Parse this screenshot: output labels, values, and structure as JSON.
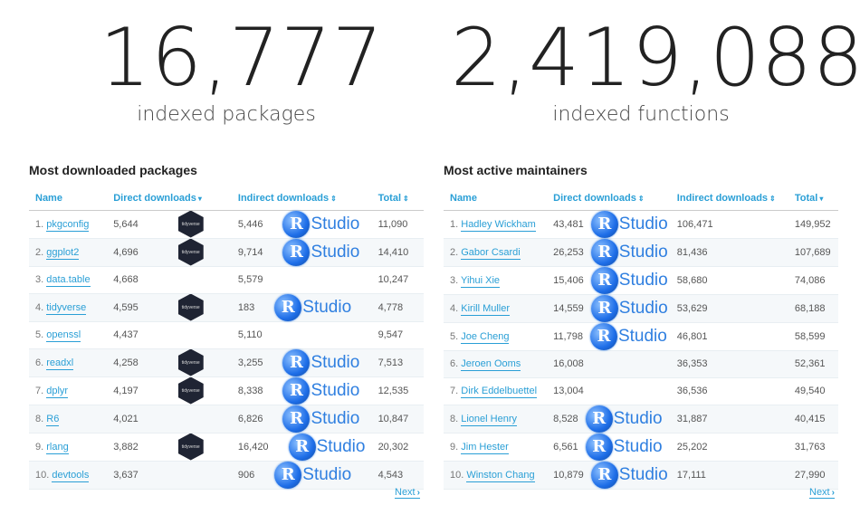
{
  "stats": {
    "packages": {
      "number": "16,777",
      "label": "indexed packages"
    },
    "functions": {
      "number": "2,419,088",
      "label": "indexed functions"
    }
  },
  "left_panel": {
    "title": "Most downloaded packages",
    "headers": {
      "name": "Name",
      "direct": "Direct downloads",
      "indirect": "Indirect downloads",
      "total": "Total"
    },
    "sort_icons": {
      "direct": "▾",
      "indirect": "⇕",
      "total": "⇕"
    },
    "rows": [
      {
        "rank": "1.",
        "name": "pkgconfig",
        "direct": "5,644",
        "indirect": "5,446",
        "total": "11,090",
        "tidyverse": true,
        "rstudio": true
      },
      {
        "rank": "2.",
        "name": "ggplot2",
        "direct": "4,696",
        "indirect": "9,714",
        "total": "14,410",
        "tidyverse": true,
        "rstudio": true
      },
      {
        "rank": "3.",
        "name": "data.table",
        "direct": "4,668",
        "indirect": "5,579",
        "total": "10,247",
        "tidyverse": false,
        "rstudio": false
      },
      {
        "rank": "4.",
        "name": "tidyverse",
        "direct": "4,595",
        "indirect": "183",
        "total": "4,778",
        "tidyverse": true,
        "rstudio": true
      },
      {
        "rank": "5.",
        "name": "openssl",
        "direct": "4,437",
        "indirect": "5,110",
        "total": "9,547",
        "tidyverse": false,
        "rstudio": false
      },
      {
        "rank": "6.",
        "name": "readxl",
        "direct": "4,258",
        "indirect": "3,255",
        "total": "7,513",
        "tidyverse": true,
        "rstudio": true
      },
      {
        "rank": "7.",
        "name": "dplyr",
        "direct": "4,197",
        "indirect": "8,338",
        "total": "12,535",
        "tidyverse": true,
        "rstudio": true
      },
      {
        "rank": "8.",
        "name": "R6",
        "direct": "4,021",
        "indirect": "6,826",
        "total": "10,847",
        "tidyverse": false,
        "rstudio": true
      },
      {
        "rank": "9.",
        "name": "rlang",
        "direct": "3,882",
        "indirect": "16,420",
        "total": "20,302",
        "tidyverse": true,
        "rstudio": true
      },
      {
        "rank": "10.",
        "name": "devtools",
        "direct": "3,637",
        "indirect": "906",
        "total": "4,543",
        "tidyverse": false,
        "rstudio": true
      }
    ],
    "next_label": "Next"
  },
  "right_panel": {
    "title": "Most active maintainers",
    "headers": {
      "name": "Name",
      "direct": "Direct downloads",
      "indirect": "Indirect downloads",
      "total": "Total"
    },
    "sort_icons": {
      "direct": "⇕",
      "indirect": "⇕",
      "total": "▾"
    },
    "rows": [
      {
        "rank": "1.",
        "name": "Hadley Wickham",
        "direct": "43,481",
        "indirect": "106,471",
        "total": "149,952",
        "rstudio": true
      },
      {
        "rank": "2.",
        "name": "Gabor Csardi",
        "direct": "26,253",
        "indirect": "81,436",
        "total": "107,689",
        "rstudio": true
      },
      {
        "rank": "3.",
        "name": "Yihui Xie",
        "direct": "15,406",
        "indirect": "58,680",
        "total": "74,086",
        "rstudio": true
      },
      {
        "rank": "4.",
        "name": "Kirill Muller",
        "direct": "14,559",
        "indirect": "53,629",
        "total": "68,188",
        "rstudio": true
      },
      {
        "rank": "5.",
        "name": "Joe Cheng",
        "direct": "11,798",
        "indirect": "46,801",
        "total": "58,599",
        "rstudio": true
      },
      {
        "rank": "6.",
        "name": "Jeroen Ooms",
        "direct": "16,008",
        "indirect": "36,353",
        "total": "52,361",
        "rstudio": false
      },
      {
        "rank": "7.",
        "name": "Dirk Eddelbuettel",
        "direct": "13,004",
        "indirect": "36,536",
        "total": "49,540",
        "rstudio": false
      },
      {
        "rank": "8.",
        "name": "Lionel Henry",
        "direct": "8,528",
        "indirect": "31,887",
        "total": "40,415",
        "rstudio": true
      },
      {
        "rank": "9.",
        "name": "Jim Hester",
        "direct": "6,561",
        "indirect": "25,202",
        "total": "31,763",
        "rstudio": true
      },
      {
        "rank": "10.",
        "name": "Winston Chang",
        "direct": "10,879",
        "indirect": "17,111",
        "total": "27,990",
        "rstudio": true
      }
    ],
    "next_label": "Next"
  },
  "badges": {
    "tidyverse_text": "tidyverse",
    "rstudio_r": "R",
    "rstudio_text": "Studio"
  },
  "colors": {
    "accent": "#2a9fd6",
    "rstudio_blue": "#2f7fe0",
    "tidyverse_hex": "#1f2433"
  },
  "icons": {
    "next": "chevron-right-icon",
    "sort_desc": "caret-down-icon",
    "sort_both": "sort-icon"
  }
}
